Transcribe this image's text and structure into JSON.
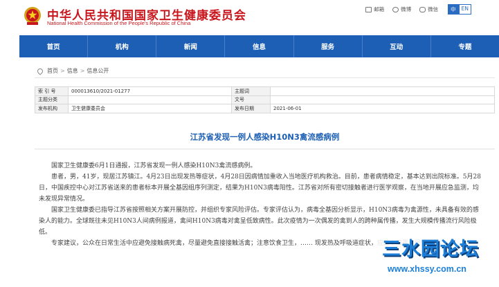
{
  "header": {
    "title": "中华人民共和国国家卫生健康委员会",
    "subtitle": "National Health Commission of the People's Republic of China",
    "links": [
      {
        "label": "邮箱",
        "icon": "mail-icon"
      },
      {
        "label": "微博",
        "icon": "weibo-icon"
      },
      {
        "label": "微信",
        "icon": "wechat-icon"
      }
    ],
    "lang_cn": "中",
    "lang_en": "EN"
  },
  "nav": {
    "items": [
      "首页",
      "机构",
      "新闻",
      "信息",
      "服务",
      "互动",
      "专题"
    ]
  },
  "breadcrumb": {
    "home": "首页",
    "sep": ">",
    "level2": "信息",
    "level3": "信息公开"
  },
  "meta": {
    "rows": [
      {
        "k1": "索 引 号",
        "v1": "000013610/2021-01277",
        "k2": "主题词",
        "v2": ""
      },
      {
        "k1": "主题分类",
        "v1": "",
        "k2": "文号",
        "v2": ""
      },
      {
        "k1": "发布机构",
        "v1": "卫生健康委员会",
        "k2": "发布日期",
        "v2": "2021-06-01"
      }
    ]
  },
  "article": {
    "title": "江苏省发现一例人感染H10N3禽流感病例",
    "paragraphs": [
      "国家卫生健康委6月1日通报，江苏省发现一例人感染H10N3禽流感病例。",
      "患者，男，41岁，现居江苏镇江。4月23日出现发热等症状，4月28日因病情加重收入当地医疗机构救治。目前，患者病情稳定，基本达到出院标准。5月28日，中国疾控中心对江苏省送来的患者标本开展全基因组序列测定，结果为H10N3病毒阳性。江苏省对所有密切接触者进行医学观察，在当地开展应急监测，均未发现异常情况。",
      "国家卫生健康委已指导江苏省按照相关方案开展防控，并组织专家风险评估。专家评估认为，病毒全基因分析显示，H10N3病毒为禽源性，未具备有效的感染人的能力。全球既往未见H10N3人间病例报道，禽间H10N3病毒对禽呈低致病性。此次疫情为一次偶发的禽到人的跨种属传播，发生大规模传播流行风险极低。",
      "专家建议，公众在日常生活中应避免接触病死禽，尽量避免直接接触活禽；注意饮食卫生，…… 现发热及呼吸道症状，应戴上口罩，尽快就医。"
    ]
  },
  "watermark": {
    "main": "三水园论坛",
    "url": "www.xhssy.com.cn"
  },
  "colors": {
    "brand_red": "#c8161d",
    "nav_blue": "#1d5fb4",
    "title_blue": "#1d5fb4"
  }
}
